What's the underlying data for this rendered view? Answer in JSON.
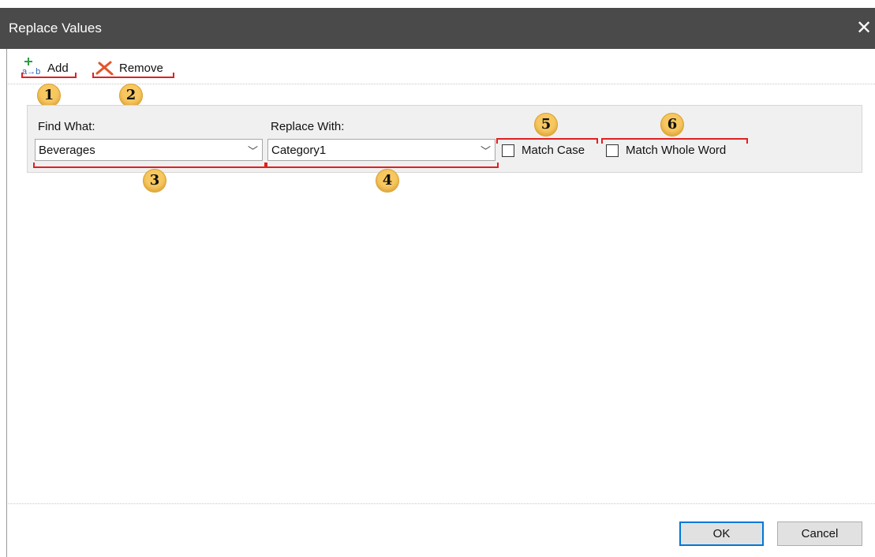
{
  "window": {
    "title": "Replace Values",
    "close_glyph": "✕"
  },
  "toolbar": {
    "add": {
      "label": "Add",
      "icon": "add-replace-icon",
      "icon_text": "a→b"
    },
    "remove": {
      "label": "Remove",
      "icon": "remove-x-icon"
    }
  },
  "callouts": [
    "1",
    "2",
    "3",
    "4",
    "5",
    "6"
  ],
  "fields": {
    "find_what": {
      "label": "Find What:",
      "value": "Beverages"
    },
    "replace_with": {
      "label": "Replace With:",
      "value": "Category1"
    }
  },
  "options": {
    "match_case": {
      "label": "Match Case",
      "checked": false
    },
    "match_whole_word": {
      "label": "Match Whole Word",
      "checked": false
    }
  },
  "buttons": {
    "ok": "OK",
    "cancel": "Cancel"
  },
  "colors": {
    "callout_bracket": "#e02020",
    "callout_fill": "#f8c860",
    "titlebar": "#4a4a4a"
  }
}
